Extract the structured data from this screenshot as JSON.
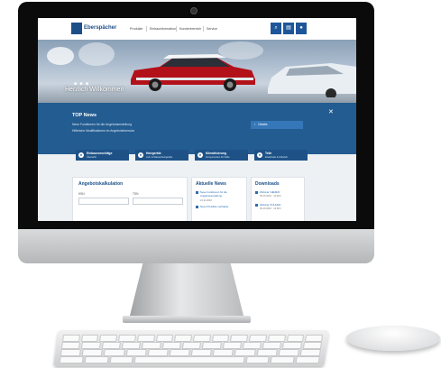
{
  "site": {
    "logo_text": "Eberspächer",
    "nav": [
      "Produkte",
      "Einbauinformation",
      "Kundenbereich",
      "Service"
    ],
    "nav_icons": [
      "search-icon",
      "document-icon",
      "user-icon"
    ]
  },
  "hero": {
    "caption": "Herzlich Willkommen",
    "dots": "■ ■ ■"
  },
  "top_news": {
    "title": "TOP News",
    "lines": [
      "Neue Funktionen für die Angebotserstellung",
      "Hilfreiche Modifikationen im Angebotsformular"
    ],
    "button_label": "Details",
    "close": "✕"
  },
  "tiles": [
    {
      "title": "Einbauvorschläge",
      "subtitle": "Übersicht"
    },
    {
      "title": "Heizgeräte",
      "subtitle": "Luft- & Wasserheizgeräte"
    },
    {
      "title": "Klimatisierung",
      "subtitle": "Komponenten für Kälte"
    },
    {
      "title": "Teile",
      "subtitle": "Ersatzteile & Zubehör"
    }
  ],
  "calculator": {
    "title": "Angebotskalkulation",
    "field1_label": "HSN",
    "field2_label": "TSN"
  },
  "news": {
    "title": "Aktuelle News",
    "items": [
      {
        "text": "Neue Funktionen für die Angebotserstellung",
        "date": "24.11.2016"
      },
      {
        "text": "Neue Preisliste verfügbar",
        "date": ""
      }
    ]
  },
  "downloads": {
    "title": "Downloads",
    "items": [
      {
        "text": "Webinar 'HEIZEN'",
        "date": "09.10.2016 · 10:00 h"
      },
      {
        "text": "Webinar 'KÜHLEN'",
        "date": "09.10.2016 · 10:00 h"
      }
    ]
  }
}
